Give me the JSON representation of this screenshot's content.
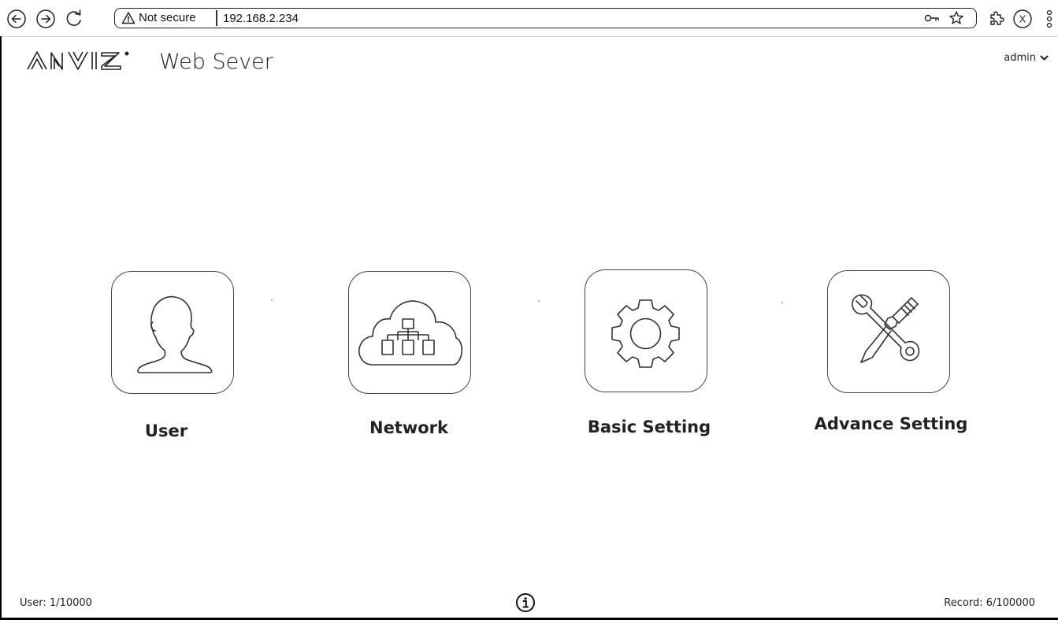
{
  "browser": {
    "security_label": "Not secure",
    "url": "192.168.2.234",
    "ext_x_label": "X"
  },
  "header": {
    "app_title": "Web Sever",
    "user_menu": "admin"
  },
  "tiles": [
    {
      "label": "User",
      "icon": "user-icon"
    },
    {
      "label": "Network",
      "icon": "network-cloud-icon"
    },
    {
      "label": "Basic Setting",
      "icon": "gear-icon"
    },
    {
      "label": "Advance Setting",
      "icon": "tools-icon"
    }
  ],
  "footer": {
    "user_count": "User: 1/10000",
    "record_count": "Record: 6/100000"
  }
}
